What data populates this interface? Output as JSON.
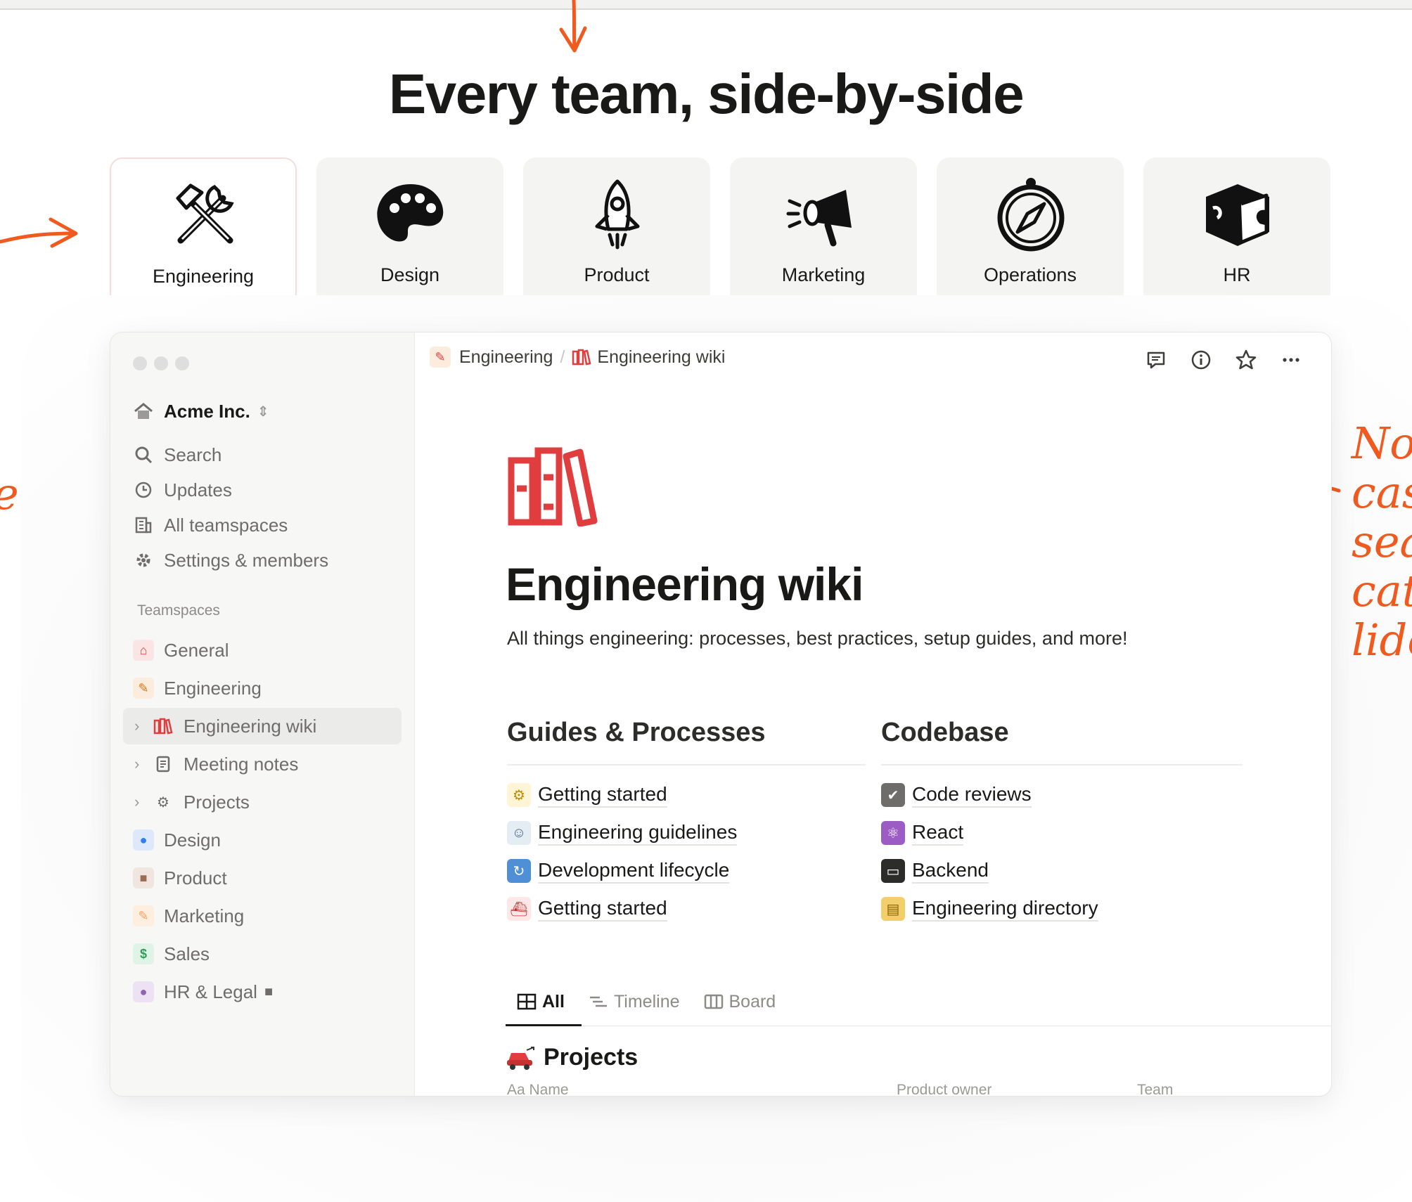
{
  "hero": {
    "title": "Every team, side-by-side"
  },
  "annotation": {
    "lines": [
      "No",
      "cas",
      "sea",
      "cat",
      "lide"
    ],
    "left_fragment": "e"
  },
  "teams": [
    {
      "label": "Engineering",
      "icon": "tools-icon",
      "active": true
    },
    {
      "label": "Design",
      "icon": "palette-icon",
      "active": false
    },
    {
      "label": "Product",
      "icon": "rocket-icon",
      "active": false
    },
    {
      "label": "Marketing",
      "icon": "megaphone-icon",
      "active": false
    },
    {
      "label": "Operations",
      "icon": "compass-icon",
      "active": false
    },
    {
      "label": "HR",
      "icon": "puzzle-icon",
      "active": false
    }
  ],
  "sidebar": {
    "workspace": "Acme Inc.",
    "nav": [
      {
        "label": "Search",
        "icon": "search-icon"
      },
      {
        "label": "Updates",
        "icon": "clock-icon"
      },
      {
        "label": "All teamspaces",
        "icon": "building-icon"
      },
      {
        "label": "Settings & members",
        "icon": "gear-icon"
      }
    ],
    "section_heading": "Teamspaces",
    "items": [
      {
        "label": "General",
        "icon": "house-icon",
        "color": "#e03e3e"
      },
      {
        "label": "Engineering",
        "icon": "wrench-icon",
        "color": "#d9730d"
      },
      {
        "label": "Engineering wiki",
        "icon": "books-icon",
        "color": "#e03e3e"
      },
      {
        "label": "Meeting notes",
        "icon": "note-icon",
        "color": "#6e6d69"
      },
      {
        "label": "Projects",
        "icon": "gears-icon",
        "color": "#6e6d69"
      },
      {
        "label": "Design",
        "icon": "palette-icon",
        "color": "#2f80ed"
      },
      {
        "label": "Product",
        "icon": "box-icon",
        "color": "#9f6b53"
      },
      {
        "label": "Marketing",
        "icon": "pencil-icon",
        "color": "#f4a261"
      },
      {
        "label": "Sales",
        "icon": "dollar-icon",
        "color": "#2f9e5a"
      },
      {
        "label": "HR & Legal",
        "icon": "person-icon",
        "color": "#9065b0"
      }
    ]
  },
  "breadcrumb": {
    "parent": "Engineering",
    "current": "Engineering wiki"
  },
  "page": {
    "title": "Engineering wiki",
    "subtitle": "All things engineering: processes, best practices, setup guides, and more!",
    "columns": [
      {
        "heading": "Guides & Processes",
        "links": [
          {
            "label": "Getting started",
            "icon": "tractor-icon"
          },
          {
            "label": "Engineering guidelines",
            "icon": "robot-icon"
          },
          {
            "label": "Development lifecycle",
            "icon": "cycle-icon"
          },
          {
            "label": "Getting started",
            "icon": "ship-icon"
          }
        ]
      },
      {
        "heading": "Codebase",
        "links": [
          {
            "label": "Code reviews",
            "icon": "check-icon"
          },
          {
            "label": "React",
            "icon": "atom-icon"
          },
          {
            "label": "Backend",
            "icon": "monitor-icon"
          },
          {
            "label": "Engineering directory",
            "icon": "folder-icon"
          }
        ]
      }
    ],
    "tabs": [
      {
        "label": "All",
        "icon": "table-icon"
      },
      {
        "label": "Timeline",
        "icon": "timeline-icon"
      },
      {
        "label": "Board",
        "icon": "board-icon"
      }
    ],
    "database_title": "Projects",
    "properties": [
      "Aa Name",
      "Product owner",
      "Team"
    ]
  }
}
